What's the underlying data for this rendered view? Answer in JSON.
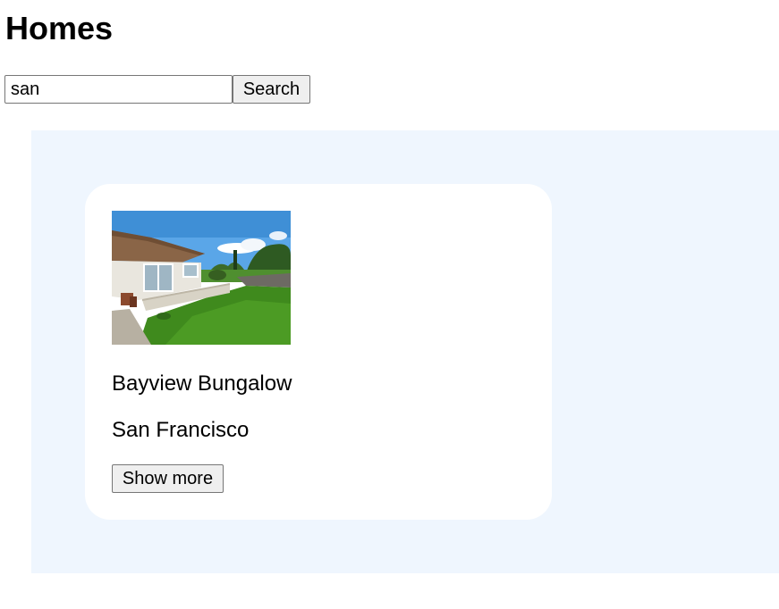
{
  "header": {
    "title": "Homes"
  },
  "search": {
    "value": "san",
    "button_label": "Search"
  },
  "results": [
    {
      "name": "Bayview Bungalow",
      "city": "San Francisco",
      "button_label": "Show more"
    }
  ],
  "colors": {
    "panel_background": "#eff6fe",
    "card_background": "#ffffff",
    "button_background": "#efefef"
  }
}
